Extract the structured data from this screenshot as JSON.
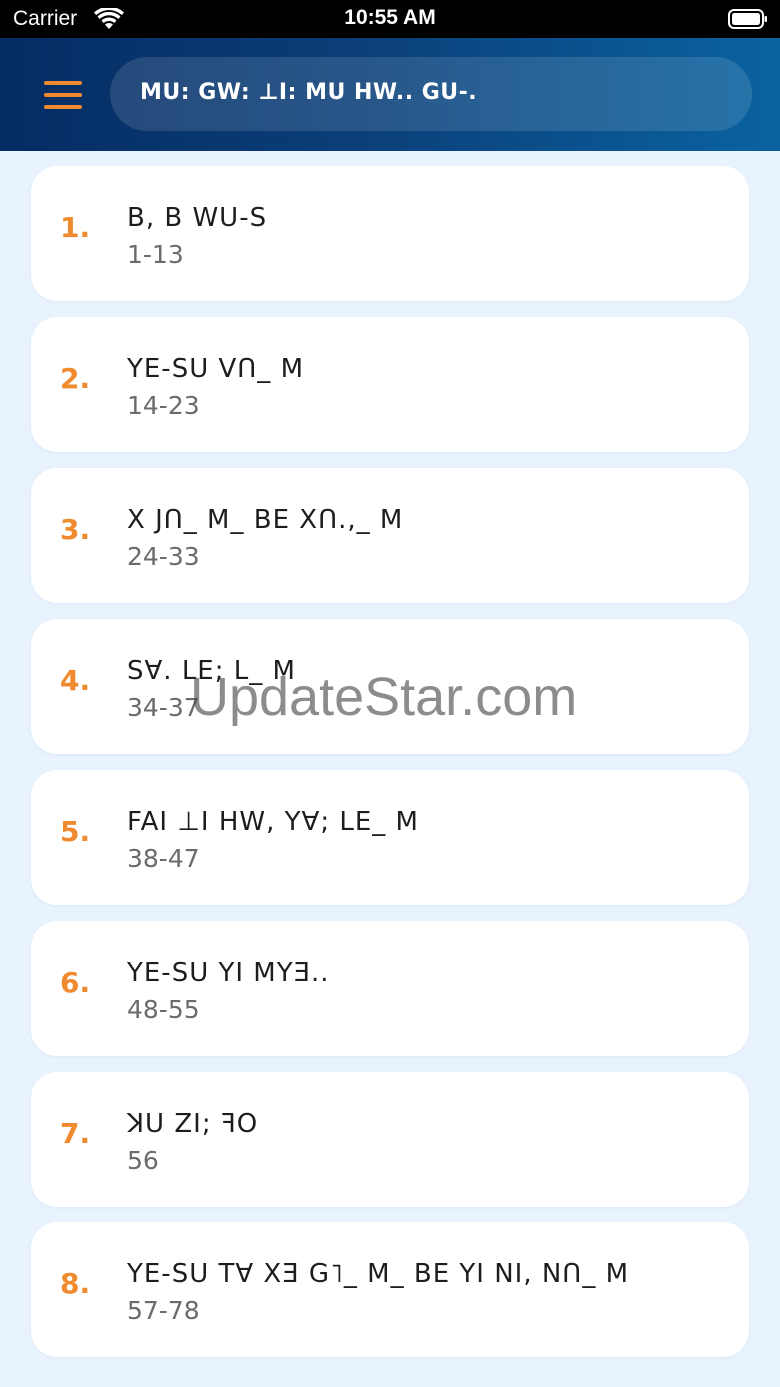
{
  "status_bar": {
    "carrier": "Carrier",
    "time": "10:55 AM"
  },
  "header": {
    "title": "MU: GW: ⊥I: MU HW.. GU-.",
    "accent_color": "#ef8a2f",
    "menu_icon": "hamburger-menu-icon"
  },
  "chapters": [
    {
      "number": "1.",
      "title": "B, B WU-S",
      "range": "1-13"
    },
    {
      "number": "2.",
      "title": "YE-SU VՈ_ M",
      "range": "14-23"
    },
    {
      "number": "3.",
      "title": "X JՈ_ M_ BE XՈ.,_ M",
      "range": "24-33"
    },
    {
      "number": "4.",
      "title": "S∀. LE; L_ M",
      "range": "34-37"
    },
    {
      "number": "5.",
      "title": "FAI ⊥I HW, Y∀; LE_ M",
      "range": "38-47"
    },
    {
      "number": "6.",
      "title": "YE-SU YI MYƎ..",
      "range": "48-55"
    },
    {
      "number": "7.",
      "title": "ꓘU ZI; ꟻO",
      "range": "56"
    },
    {
      "number": "8.",
      "title": "YE-SU T∀  XƎ G˥_ M_ BE YI NI, NՈ_ M",
      "range": "57-78"
    }
  ],
  "watermark": "UpdateStar.com"
}
